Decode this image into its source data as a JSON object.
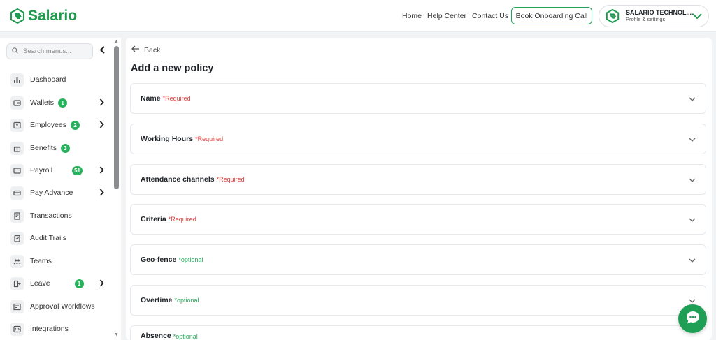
{
  "header": {
    "logo_text": "Salario",
    "nav": [
      "Home",
      "Help Center",
      "Contact Us"
    ],
    "book_button": "Book Onboarding Call",
    "profile": {
      "org_name": "SALARIO TECHNOL....",
      "subtitle": "Profile & settings"
    }
  },
  "sidebar": {
    "search_placeholder": "Search menus...",
    "items": [
      {
        "label": "Dashboard",
        "icon": "bar-chart-icon",
        "badge": "",
        "arrow": false
      },
      {
        "label": "Wallets",
        "icon": "wallet-icon",
        "badge": "1",
        "arrow": true
      },
      {
        "label": "Employees",
        "icon": "employee-icon",
        "badge": "2",
        "arrow": true
      },
      {
        "label": "Benefits",
        "icon": "gift-icon",
        "badge": "3",
        "arrow": false
      },
      {
        "label": "Payroll",
        "icon": "payroll-icon",
        "badge": "51",
        "arrow": true
      },
      {
        "label": "Pay Advance",
        "icon": "card-icon",
        "badge": "",
        "arrow": true
      },
      {
        "label": "Transactions",
        "icon": "receipt-icon",
        "badge": "",
        "arrow": false
      },
      {
        "label": "Audit Trails",
        "icon": "audit-icon",
        "badge": "",
        "arrow": false
      },
      {
        "label": "Teams",
        "icon": "team-icon",
        "badge": "",
        "arrow": false
      },
      {
        "label": "Leave",
        "icon": "leave-icon",
        "badge": "1",
        "arrow": true
      },
      {
        "label": "Approval Workflows",
        "icon": "workflow-icon",
        "badge": "",
        "arrow": false
      },
      {
        "label": "Integrations",
        "icon": "code-icon",
        "badge": "",
        "arrow": false
      }
    ]
  },
  "main": {
    "back_label": "Back",
    "title": "Add a new policy",
    "sections": [
      {
        "title": "Name",
        "tag": "*Required",
        "kind": "required"
      },
      {
        "title": "Working Hours",
        "tag": "*Required",
        "kind": "required"
      },
      {
        "title": "Attendance channels",
        "tag": "*Required",
        "kind": "required"
      },
      {
        "title": "Criteria",
        "tag": "*Required",
        "kind": "required"
      },
      {
        "title": "Geo-fence",
        "tag": "*optional",
        "kind": "optional"
      },
      {
        "title": "Overtime",
        "tag": "*optional",
        "kind": "optional"
      },
      {
        "title": "Absence",
        "tag": "*optional",
        "kind": "optional"
      }
    ]
  },
  "colors": {
    "brand": "#1e9b4f",
    "required": "#e23b3b",
    "optional": "#28a85a",
    "badge": "#28b15c"
  },
  "icons": {
    "chat": "chat-bubble-icon",
    "back": "arrow-left-icon",
    "expand": "chevron-down-icon"
  }
}
